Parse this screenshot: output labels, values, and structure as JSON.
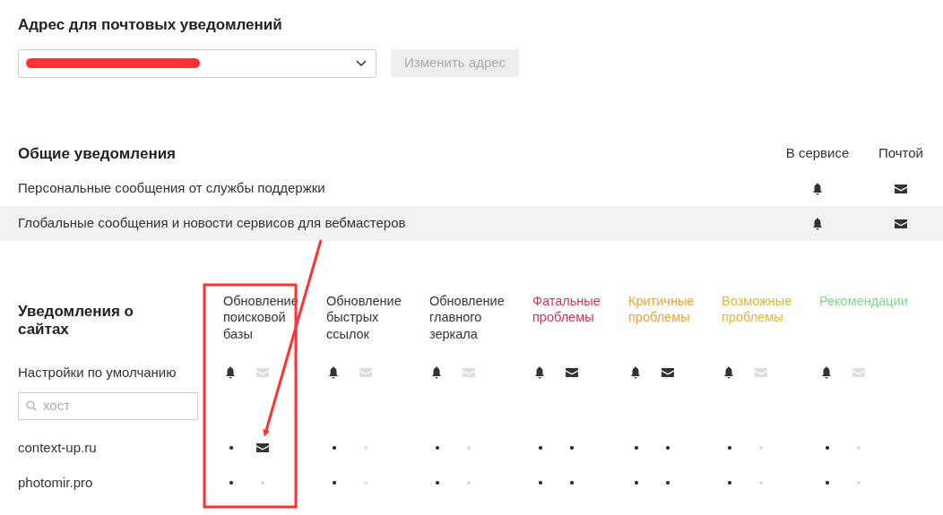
{
  "mail_address": {
    "title": "Адрес для почтовых уведомлений",
    "redacted": true,
    "button": "Изменить адрес",
    "button_disabled": true
  },
  "general": {
    "title": "Общие уведомления",
    "columns": [
      "В сервисе",
      "Почтой"
    ],
    "items": [
      {
        "label": "Персональные сообщения от службы поддержки",
        "service": true,
        "mail": true,
        "hovered": false
      },
      {
        "label": "Глобальные сообщения и новости сервисов для вебмастеров",
        "service": true,
        "mail": true,
        "hovered": true
      }
    ]
  },
  "sites": {
    "title": "Уведомления о сайтах",
    "columns": [
      {
        "label": "Обновление поисковой базы",
        "color": "#333333"
      },
      {
        "label": "Обновление быстрых ссылок",
        "color": "#333333"
      },
      {
        "label": "Обновление главного зеркала",
        "color": "#333333"
      },
      {
        "label": "Фатальные проблемы",
        "color": "#d9344f"
      },
      {
        "label": "Критичные проблемы",
        "color": "#f5a030"
      },
      {
        "label": "Возможные проблемы",
        "color": "#e5b436"
      },
      {
        "label": "Рекомендации",
        "color": "#7fd98c"
      }
    ],
    "defaults": {
      "label": "Настройки по умолчанию",
      "cells": [
        {
          "service": true,
          "mail": false
        },
        {
          "service": true,
          "mail": false
        },
        {
          "service": true,
          "mail": false
        },
        {
          "service": true,
          "mail": true
        },
        {
          "service": true,
          "mail": true
        },
        {
          "service": true,
          "mail": false
        },
        {
          "service": true,
          "mail": false
        }
      ]
    },
    "search": {
      "placeholder": "хост"
    },
    "rows": [
      {
        "host": "context-up.ru",
        "cells": [
          {
            "service_custom": false,
            "mail_custom": true
          },
          {
            "service_custom": false,
            "mail_custom": false
          },
          {
            "service_custom": false,
            "mail_custom": false
          },
          {
            "service_custom": false,
            "mail_custom": false
          },
          {
            "service_custom": false,
            "mail_custom": false
          },
          {
            "service_custom": false,
            "mail_custom": false
          },
          {
            "service_custom": false,
            "mail_custom": false
          }
        ]
      },
      {
        "host": "photomir.pro",
        "cells": [
          {
            "service_custom": false,
            "mail_custom": false
          },
          {
            "service_custom": false,
            "mail_custom": false
          },
          {
            "service_custom": false,
            "mail_custom": false
          },
          {
            "service_custom": false,
            "mail_custom": false
          },
          {
            "service_custom": false,
            "mail_custom": false
          },
          {
            "service_custom": false,
            "mail_custom": false
          },
          {
            "service_custom": false,
            "mail_custom": false
          }
        ]
      }
    ]
  }
}
